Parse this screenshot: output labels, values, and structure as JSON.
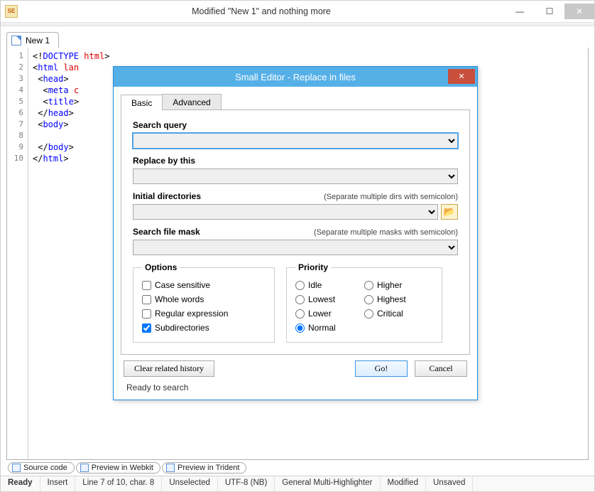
{
  "window": {
    "app_initials": "SE",
    "title": "Modified \"New 1\" and nothing more"
  },
  "docTabs": [
    {
      "label": "New 1"
    }
  ],
  "gutter_lines": [
    "1",
    "2",
    "3",
    "4",
    "5",
    "6",
    "7",
    "8",
    "9",
    "10"
  ],
  "code_lines": [
    {
      "indent": 0,
      "pre": "<!",
      "tag": "DOCTYPE",
      "mid": " ",
      "attr": "html",
      "post": ">"
    },
    {
      "indent": 0,
      "pre": "<",
      "tag": "html",
      "mid": " ",
      "attr": "lan",
      "post": ""
    },
    {
      "indent": 1,
      "pre": "<",
      "tag": "head",
      "mid": "",
      "attr": "",
      "post": ">"
    },
    {
      "indent": 2,
      "pre": "<",
      "tag": "meta",
      "mid": " ",
      "attr": "c",
      "post": ""
    },
    {
      "indent": 2,
      "pre": "<",
      "tag": "title",
      "mid": "",
      "attr": "",
      "post": ">"
    },
    {
      "indent": 1,
      "pre": "</",
      "tag": "head",
      "mid": "",
      "attr": "",
      "post": ">"
    },
    {
      "indent": 1,
      "pre": "<",
      "tag": "body",
      "mid": "",
      "attr": "",
      "post": ">"
    },
    {
      "indent": 0,
      "pre": "",
      "tag": "",
      "mid": "",
      "attr": "",
      "post": ""
    },
    {
      "indent": 1,
      "pre": "</",
      "tag": "body",
      "mid": "",
      "attr": "",
      "post": ">"
    },
    {
      "indent": 0,
      "pre": "</",
      "tag": "html",
      "mid": "",
      "attr": "",
      "post": ">"
    }
  ],
  "viewTabs": [
    {
      "label": "Source code"
    },
    {
      "label": "Preview in Webkit"
    },
    {
      "label": "Preview in Trident"
    }
  ],
  "status": {
    "state": "Ready",
    "mode": "Insert",
    "cursor": "Line 7 of 10, char. 8",
    "selection": "Unselected",
    "encoding": "UTF-8 (NB)",
    "highlighter": "General Multi-Highlighter",
    "dirty": "Modified",
    "saved": "Unsaved"
  },
  "dialog": {
    "title": "Small Editor - Replace in files",
    "tabs": {
      "basic": "Basic",
      "advanced": "Advanced"
    },
    "fields": {
      "search_query_label": "Search query",
      "search_query_value": "",
      "replace_label": "Replace by this",
      "replace_value": "",
      "dirs_label": "Initial directories",
      "dirs_hint": "(Separate multiple dirs with semicolon)",
      "dirs_value": "",
      "mask_label": "Search file mask",
      "mask_hint": "(Separate multiple masks with semicolon)",
      "mask_value": ""
    },
    "options": {
      "legend": "Options",
      "case_sensitive": {
        "label": "Case sensitive",
        "checked": false
      },
      "whole_words": {
        "label": "Whole words",
        "checked": false
      },
      "regex": {
        "label": "Regular expression",
        "checked": false
      },
      "subdirs": {
        "label": "Subdirectories",
        "checked": true
      }
    },
    "priority": {
      "legend": "Priority",
      "items": {
        "idle": {
          "label": "Idle",
          "selected": false
        },
        "lowest": {
          "label": "Lowest",
          "selected": false
        },
        "lower": {
          "label": "Lower",
          "selected": false
        },
        "normal": {
          "label": "Normal",
          "selected": true
        },
        "higher": {
          "label": "Higher",
          "selected": false
        },
        "highest": {
          "label": "Highest",
          "selected": false
        },
        "critical": {
          "label": "Critical",
          "selected": false
        }
      }
    },
    "actions": {
      "clear_history": "Clear related history",
      "go": "Go!",
      "cancel": "Cancel"
    },
    "status_text": "Ready to search"
  }
}
